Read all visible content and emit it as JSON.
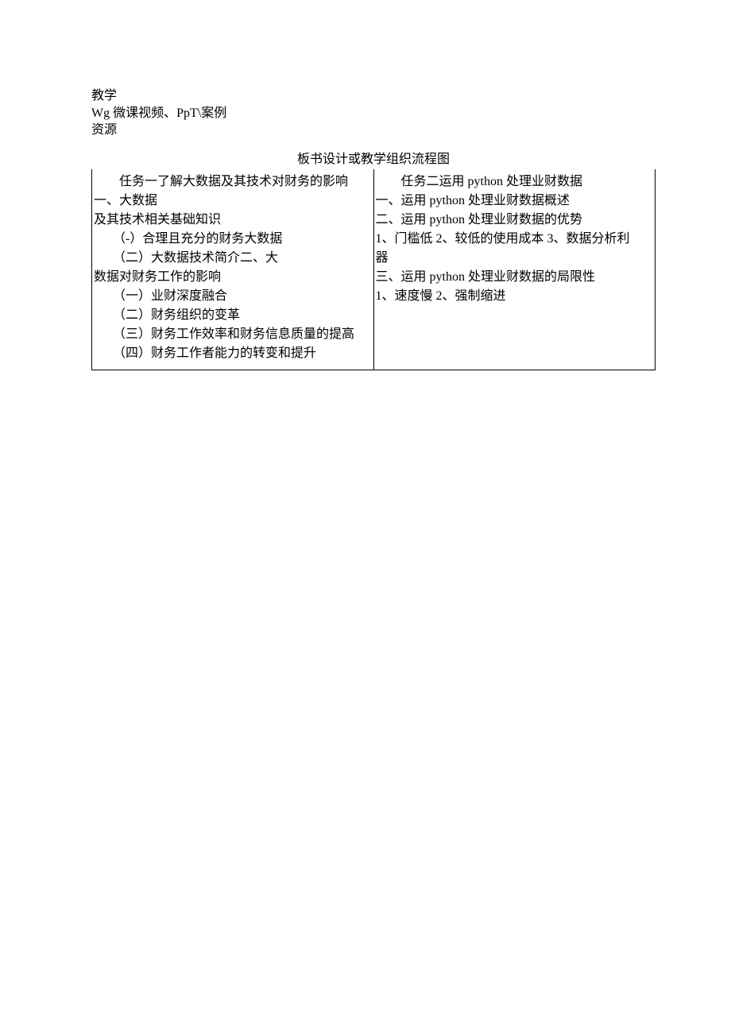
{
  "header": {
    "line1": "教学",
    "line2": "Wg 微课视频、PpT\\案例",
    "line3": "资源"
  },
  "title": "板书设计或教学组织流程图",
  "left": {
    "l1": "任务一了解大数据及其技术对财务的影响一、大数据",
    "l2": "及其技术相关基础知识",
    "l3": "（-）合理且充分的财务大数据",
    "l4": "（二）大数据技术简介二、大",
    "l5": "数据对财务工作的影响",
    "l6": "（一）业财深度融合",
    "l7": "（二）财务组织的变革",
    "l8": "（三）财务工作效率和财务信息质量的提高",
    "l9": "（四）财务工作者能力的转变和提升"
  },
  "right": {
    "r1": "任务二运用 python 处理业财数据",
    "r2": "一、运用 python 处理业财数据概述",
    "r3": "二、运用 python 处理业财数据的优势",
    "r4": "1、门槛低 2、较低的使用成本 3、数据分析利",
    "r5": "器",
    "r6": "三、运用 python 处理业财数据的局限性",
    "r7": "1、速度慢 2、强制缩进"
  }
}
